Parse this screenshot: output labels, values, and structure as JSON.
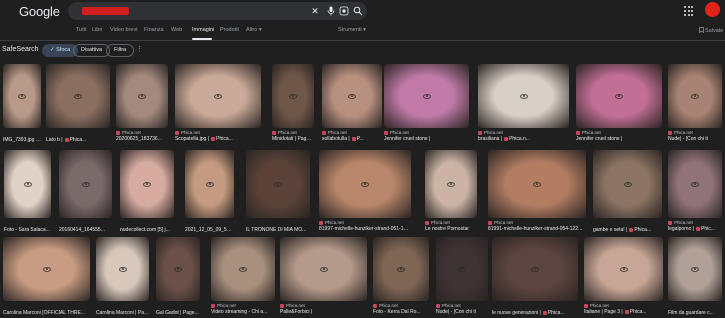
{
  "header": {
    "logo": "Google",
    "search_query_redacted": true,
    "icons": [
      "close-icon",
      "microphone-icon",
      "lens-icon",
      "search-icon"
    ],
    "apps_icon": "apps-grid-icon",
    "avatar_color": "#e2231a"
  },
  "tabs": [
    {
      "label": "Tutti",
      "active": false
    },
    {
      "label": "Libri",
      "active": false
    },
    {
      "label": "Video brevi",
      "active": false
    },
    {
      "label": "Finanza",
      "active": false
    },
    {
      "label": "Web",
      "active": false
    },
    {
      "label": "Immagini",
      "active": true
    },
    {
      "label": "Prodotti",
      "active": false
    },
    {
      "label": "Altro ▾",
      "active": false
    }
  ],
  "tools_label": "Strumenti ▾",
  "saved_label": "Salvate",
  "safesearch": {
    "label": "SafeSearch",
    "options": [
      {
        "label": "✓ Sfoca",
        "selected": true
      },
      {
        "label": "Disattiva",
        "selected": false
      },
      {
        "label": "Filtra",
        "selected": false
      }
    ],
    "more_icon": "more-vert-icon"
  },
  "results": [
    {
      "source": "",
      "title": "IMG_7393.jpg |",
      "color": "#b89a88",
      "sfav": true,
      "sp": "P..."
    },
    {
      "source": "",
      "title": "Lato b |",
      "color": "#8a6e60",
      "sfav": true,
      "sp": "Phica..."
    },
    {
      "source": "Phica.net",
      "title": "20200625_183736...",
      "color": "#a48a7e",
      "sfav": false,
      "sp": ""
    },
    {
      "source": "Phica.net",
      "title": "Scopatella.jpg |",
      "color": "#c9a997",
      "sfav": true,
      "sp": "Phica..."
    },
    {
      "source": "Phica.net",
      "title": "Minidotati | Page 3...",
      "color": "#6e5648",
      "sfav": false,
      "sp": ""
    },
    {
      "source": "Phica.net",
      "title": "sollabotulla |",
      "color": "#b89080",
      "sfav": true,
      "sp": "P..."
    },
    {
      "source": "Phica.net",
      "title": "Jennifer cruel stone |",
      "color": "#c07aa8",
      "sfav": false,
      "sp": ""
    },
    {
      "source": "Phica.net",
      "title": "brasiliana |",
      "color": "#d8d0c6",
      "sfav": true,
      "sp": "Phica.n..."
    },
    {
      "source": "Phica.net",
      "title": "Jennifer cruel stone |",
      "color": "#c26f95",
      "sfav": false,
      "sp": ""
    },
    {
      "source": "Phica.net",
      "title": "Nude| - [Con chi ti",
      "color": "#a88272",
      "sfav": false,
      "sp": ""
    },
    {
      "source": "",
      "title": "Foto - Sara Salaca...",
      "color": "#e0d2c6",
      "sfav": false,
      "sp": ""
    },
    {
      "source": "",
      "title": "20160414_164555...",
      "color": "#7a6a6a",
      "sfav": false,
      "sp": ""
    },
    {
      "source": "",
      "title": "nudecollect.com [5] j...",
      "color": "#d6aca0",
      "sfav": false,
      "sp": ""
    },
    {
      "source": "",
      "title": "2021_12_05_09_52_...",
      "color": "#c49a80",
      "sfav": false,
      "sp": ""
    },
    {
      "source": "",
      "title": "IL TRONONE DI MIA MO...",
      "color": "#5a4238",
      "sfav": false,
      "sp": ""
    },
    {
      "source": "Phica.net",
      "title": "81997-michelle-hunziker-strand-051-122...",
      "color": "#b8866a",
      "sfav": false,
      "sp": ""
    },
    {
      "source": "Phica.net",
      "title": "Le nostre Pornostar",
      "color": "#cbb4a6",
      "sfav": false,
      "sp": ""
    },
    {
      "source": "Phica.net",
      "title": "81991-michelle-hunziker-strand-054-122...",
      "color": "#b37d62",
      "sfav": false,
      "sp": ""
    },
    {
      "source": "",
      "title": "gambe e seta! |",
      "color": "#8c7464",
      "sfav": true,
      "sp": "Phica..."
    },
    {
      "source": "Phica.net",
      "title": "legalporno |",
      "color": "#90727a",
      "sfav": true,
      "sp": "Phic..."
    },
    {
      "source": "",
      "title": "Carolina Marconi [OFFICIAL THRE...",
      "color": "#c89c82",
      "sfav": false,
      "sp": ""
    },
    {
      "source": "",
      "title": "Carolina Marconi | Page...",
      "color": "#d8c8bc",
      "sfav": false,
      "sp": ""
    },
    {
      "source": "",
      "title": "Gal Gadot | Page...",
      "color": "#6a5048",
      "sfav": false,
      "sp": ""
    },
    {
      "source": "Phica.net",
      "title": "Video streaming - Chi a...",
      "color": "#a8907e",
      "sfav": false,
      "sp": ""
    },
    {
      "source": "Phica.net",
      "title": "Palle&Forbici |",
      "color": "#b49a8a",
      "sfav": false,
      "sp": ""
    },
    {
      "source": "Phica.net",
      "title": "Foto - Kerra Dal Ro...",
      "color": "#7e6654",
      "sfav": false,
      "sp": ""
    },
    {
      "source": "Phica.net",
      "title": "Nude| - [Con chi ti",
      "color": "#3e3436",
      "sfav": false,
      "sp": ""
    },
    {
      "source": "",
      "title": "le nuove generazioni |",
      "color": "#5c4440",
      "sfav": true,
      "sp": "Phica..."
    },
    {
      "source": "Phica.net",
      "title": "Italiane | Page 3 |",
      "color": "#c7a696",
      "sfav": true,
      "sp": "Phica..."
    },
    {
      "source": "",
      "title": "Film da guardare c...",
      "color": "#b0a098",
      "sfav": false,
      "sp": ""
    }
  ]
}
